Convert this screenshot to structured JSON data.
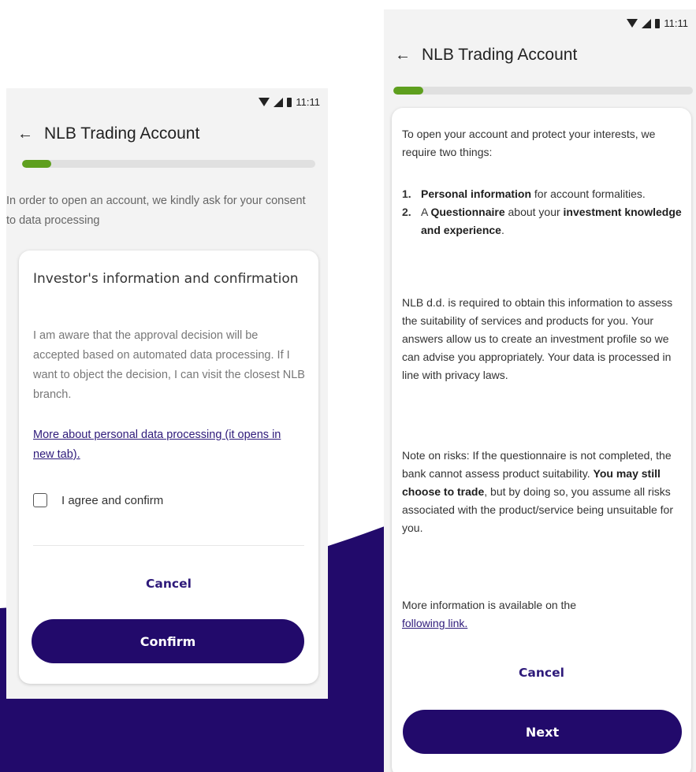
{
  "colors": {
    "brand_primary": "#220a6b",
    "accent_green": "#5e9f1e",
    "link": "#2e1a7a",
    "background": "#f3f3f3",
    "card": "#ffffff"
  },
  "status_bar": {
    "time": "11:11"
  },
  "left_screen": {
    "title": "NLB Trading Account",
    "progress_fraction": 0.1,
    "intro_text": "In order to open an account, we kindly ask for your consent to data processing",
    "card": {
      "title": "Investor's information and confirmation",
      "body": "I am aware that the approval decision will be accepted based on automated data processing. If I want to object the decision, I can visit the closest NLB branch.",
      "link_text": "More about personal data processing (it opens in new tab).",
      "checkbox_label": "I agree and confirm",
      "checkbox_checked": false,
      "cancel_label": "Cancel",
      "confirm_label": "Confirm"
    }
  },
  "right_screen": {
    "title": "NLB Trading Account",
    "progress_fraction": 0.1,
    "intro": "To open your account and protect your interests, we require two things:",
    "items": [
      {
        "num": "1.",
        "bold": "Personal information",
        "rest": " for account formalities."
      },
      {
        "num": "2.",
        "pre": "A ",
        "bold1": "Questionnaire",
        "mid": " about your ",
        "bold2": "investment knowledge and experience",
        "post": "."
      }
    ],
    "para1": "NLB d.d. is required to obtain this information to assess the suitability of services and products for you. Your answers allow us to create an investment profile so we can advise you appropriately. Your data is processed in line with privacy laws.",
    "para2_start": "Note on risks: If the questionnaire is not completed, the bank cannot assess product suitability. ",
    "para2_bold": "You may still choose to trade",
    "para2_end": ", but by doing so, you assume all risks associated with the product/service being unsuitable for you.",
    "more_info": "More information is available on the ",
    "more_link": "following link.",
    "cancel_label": "Cancel",
    "next_label": "Next"
  }
}
